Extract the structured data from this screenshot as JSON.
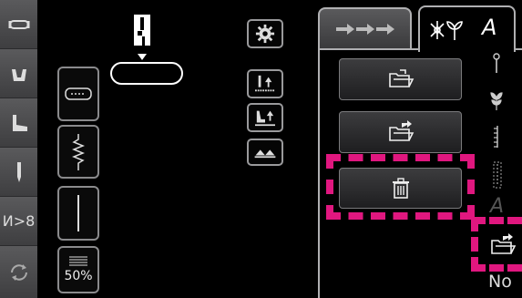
{
  "sidebar": {
    "items": [
      {
        "icon": "buttonhole-icon"
      },
      {
        "icon": "presser-foot-icon"
      },
      {
        "icon": "sock-foot-icon"
      },
      {
        "icon": "needle-icon"
      },
      {
        "icon": "thread-cutter-icon",
        "label": "И>8"
      },
      {
        "icon": "reverse-rotate-icon"
      }
    ]
  },
  "stitch_panel": {
    "percent_label": "50%"
  },
  "tabs": [
    {
      "name": "stitch-sequence-tab",
      "icon": "arrows-icon"
    },
    {
      "name": "embroidery-text-tab",
      "icon": "flower-text-icon",
      "label": "A"
    }
  ],
  "file_actions": {
    "open_icon": "folder-open-icon",
    "save_icon": "folder-save-icon",
    "delete_icon": "trash-icon"
  },
  "right_column": {
    "save_icon": "folder-arrow-icon",
    "no_label": "No",
    "letter": "A"
  },
  "colors": {
    "highlight": "#e0177f",
    "sidebar": "#4f4f51",
    "background": "#000000"
  }
}
